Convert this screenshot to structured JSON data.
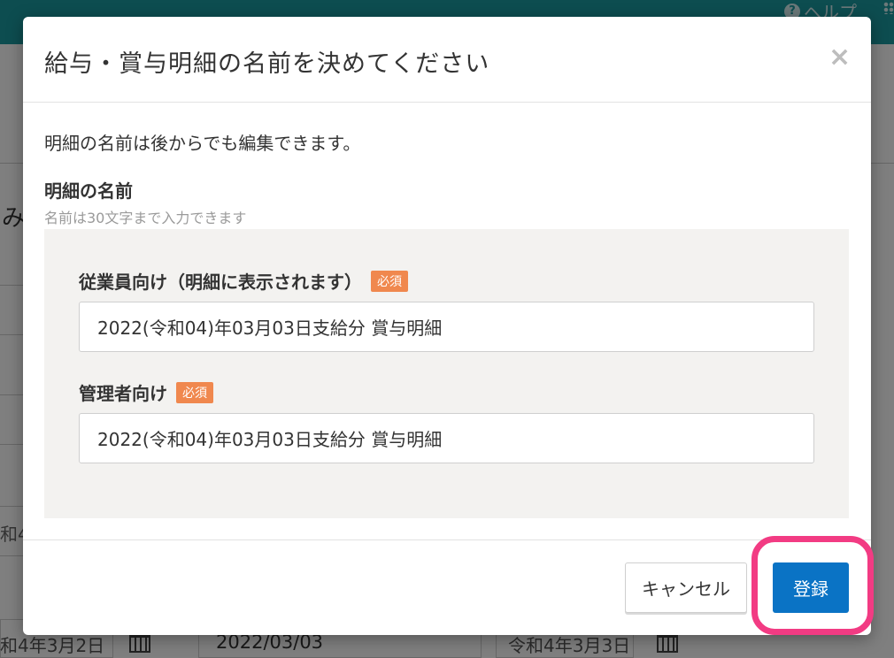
{
  "background": {
    "help_label": "ヘルプ",
    "side_char": "み",
    "left_tag": "和4",
    "date_left": "和4年3月2日",
    "date_mid": "2022/03/03",
    "date_right": "令和4年3月3日"
  },
  "modal": {
    "title": "給与・賞与明細の名前を決めてください",
    "close_label": "×",
    "description": "明細の名前は後からでも編集できます。",
    "section_title": "明細の名前",
    "section_hint": "名前は30文字まで入力できます",
    "fields": [
      {
        "label": "従業員向け（明細に表示されます）",
        "badge": "必須",
        "value": "2022(令和04)年03月03日支給分 賞与明細"
      },
      {
        "label": "管理者向け",
        "badge": "必須",
        "value": "2022(令和04)年03月03日支給分 賞与明細"
      }
    ],
    "cancel_label": "キャンセル",
    "submit_label": "登録"
  },
  "colors": {
    "topbar": "#1b9aa0",
    "primary_button": "#0a73c5",
    "required_badge": "#f0884e",
    "highlight_ring": "#f23b83"
  }
}
